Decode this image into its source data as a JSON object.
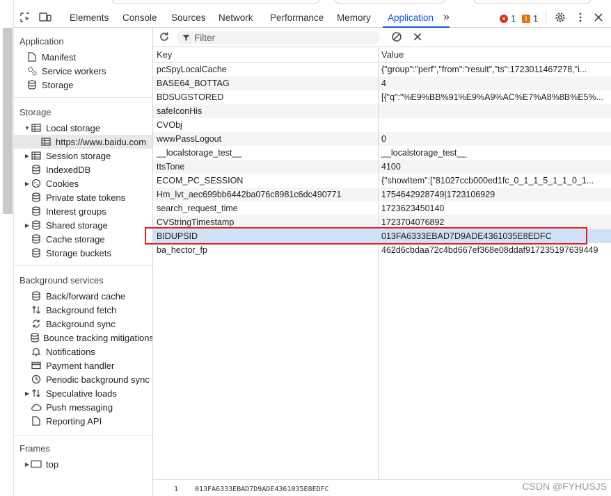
{
  "devtools": {
    "tabs": [
      "Elements",
      "Console",
      "Sources",
      "Network",
      "Performance",
      "Memory",
      "Application"
    ],
    "active_tab": "Application",
    "more_tabs_glyph": "»",
    "errors_count": "1",
    "warnings_count": "1"
  },
  "sidebar": {
    "application_title": "Application",
    "application_items": [
      "Manifest",
      "Service workers",
      "Storage"
    ],
    "storage_title": "Storage",
    "local_storage": "Local storage",
    "local_storage_origin": "https://www.baidu.com",
    "storage_items": [
      "Session storage",
      "IndexedDB",
      "Cookies",
      "Private state tokens",
      "Interest groups",
      "Shared storage",
      "Cache storage",
      "Storage buckets"
    ],
    "background_title": "Background services",
    "background_items": [
      "Back/forward cache",
      "Background fetch",
      "Background sync",
      "Bounce tracking mitigations",
      "Notifications",
      "Payment handler",
      "Periodic background sync",
      "Speculative loads",
      "Push messaging",
      "Reporting API"
    ],
    "frames_title": "Frames",
    "frames_items": [
      "top"
    ]
  },
  "toolbar": {
    "filter_placeholder": "Filter"
  },
  "table": {
    "columns": [
      "Key",
      "Value"
    ],
    "rows": [
      {
        "key": "pcSpyLocalCache",
        "value": "{\"group\":\"perf\",\"from\":\"result\",\"ts\":1723011467278,\"i..."
      },
      {
        "key": "BASE64_BOTTAG",
        "value": "4"
      },
      {
        "key": "BDSUGSTORED",
        "value": "[{\"q\":\"%E9%BB%91%E9%A9%AC%E7%A8%8B%E5%..."
      },
      {
        "key": "safeIconHis",
        "value": ""
      },
      {
        "key": "CVObj",
        "value": ""
      },
      {
        "key": "wwwPassLogout",
        "value": "0"
      },
      {
        "key": "__localstorage_test__",
        "value": "__localstorage_test__"
      },
      {
        "key": "ttsTone",
        "value": "4100"
      },
      {
        "key": "ECOM_PC_SESSION",
        "value": "{\"showItem\":[\"81027ccb000ed1fc_0_1_1_5_1_1_0_1..."
      },
      {
        "key": "Hm_lvt_aec699bb6442ba076c8981c6dc490771",
        "value": "1754642928749|1723106929"
      },
      {
        "key": "search_request_time",
        "value": "1723623450140"
      },
      {
        "key": "CVStringTimestamp",
        "value": "1723704076892"
      },
      {
        "key": "BIDUPSID",
        "value": "013FA6333EBAD7D9ADE4361035E8EDFC"
      },
      {
        "key": "ba_hector_fp",
        "value": "462d6cbdaa72c4bd667ef368e08ddaf917235197639449"
      }
    ],
    "selected_key": "BIDUPSID"
  },
  "preview": {
    "line_number": "1",
    "value": "013FA6333EBAD7D9ADE4361035E8EDFC"
  },
  "watermark": "CSDN @FYHUSJS",
  "colors": {
    "accent": "#0b57d0",
    "selected_row": "#cfe0f7",
    "highlight_box": "#e02020"
  }
}
